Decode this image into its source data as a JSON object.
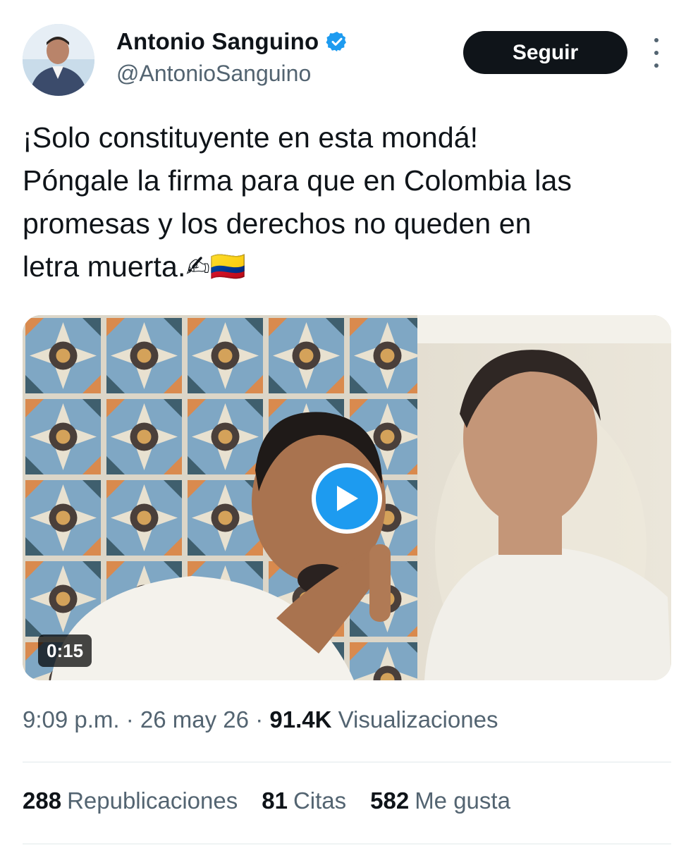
{
  "author": {
    "display_name": "Antonio Sanguino",
    "handle": "@AntonioSanguino",
    "verified_icon": "verified-badge-icon",
    "avatar_icon": "profile-photo"
  },
  "actions": {
    "follow_label": "Seguir",
    "more_icon": "more-options-icon"
  },
  "tweet": {
    "lines": [
      "¡Solo constituyente en esta mondá!",
      "Póngale la firma para que en Colombia las",
      "promesas y los derechos no queden en",
      "letra muerta.✍🇨🇴"
    ],
    "emoji_writing": "✍",
    "emoji_flag": "🇨🇴"
  },
  "media": {
    "type": "video",
    "duration": "0:15",
    "play_icon": "play-icon"
  },
  "meta": {
    "time": "9:09 p.m.",
    "separator": "·",
    "date": "26 may 26",
    "views_count": "91.4K",
    "views_label": "Visualizaciones"
  },
  "stats": {
    "reposts_count": "288",
    "reposts_label": "Republicaciones",
    "quotes_count": "81",
    "quotes_label": "Citas",
    "likes_count": "582",
    "likes_label": "Me gusta"
  },
  "colors": {
    "text_primary": "#0f1419",
    "text_secondary": "#536471",
    "accent_blue": "#1d9bf0",
    "follow_bg": "#0f1419",
    "divider": "#eff3f4"
  }
}
